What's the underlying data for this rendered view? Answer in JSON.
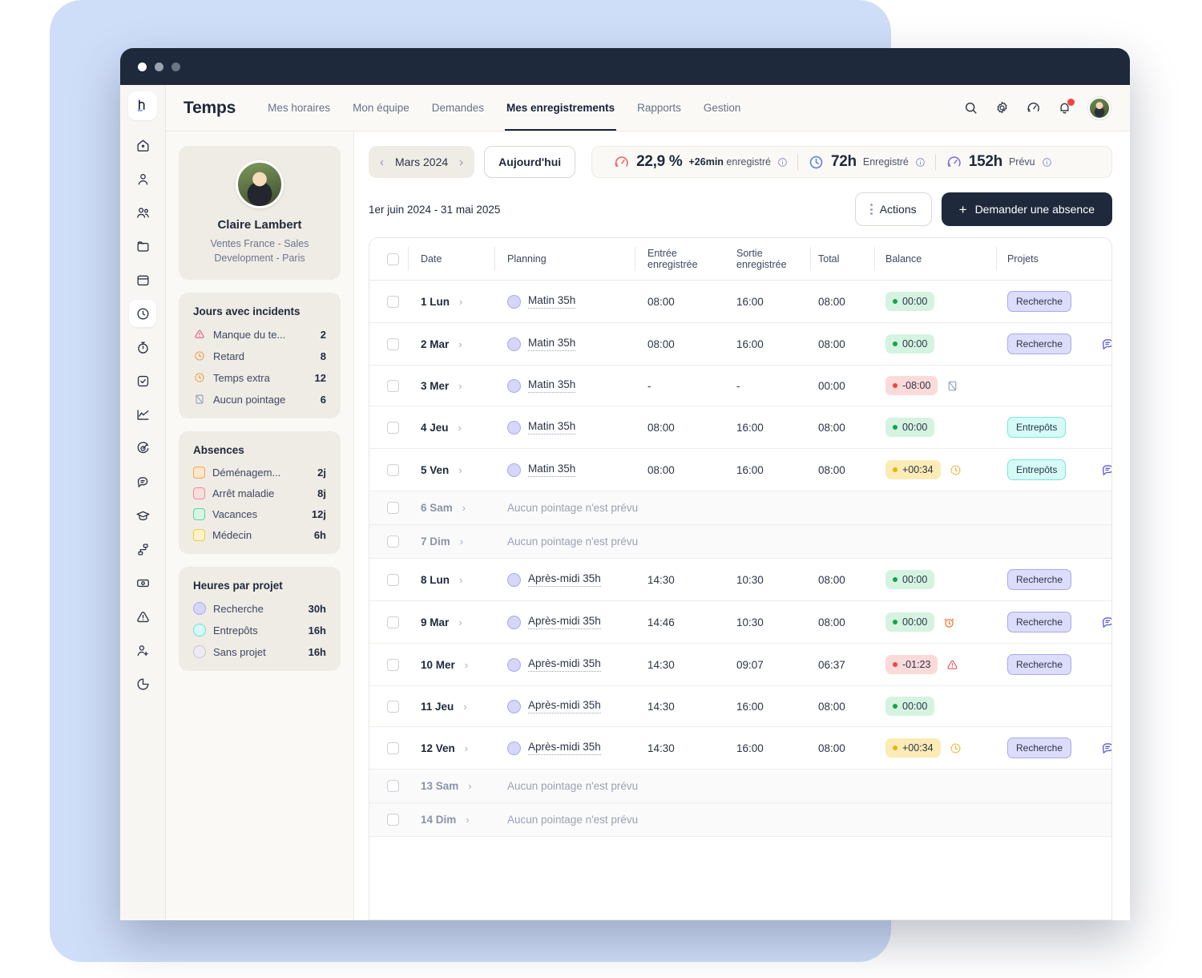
{
  "window": {
    "dots": [
      "close",
      "minimize",
      "maximize"
    ]
  },
  "header": {
    "brand": "Temps",
    "tabs": [
      {
        "label": "Mes horaires",
        "active": false
      },
      {
        "label": "Mon équipe",
        "active": false
      },
      {
        "label": "Demandes",
        "active": false
      },
      {
        "label": "Mes enregistrements",
        "active": true
      },
      {
        "label": "Rapports",
        "active": false
      },
      {
        "label": "Gestion",
        "active": false
      }
    ],
    "icons": [
      "search-icon",
      "gear-icon",
      "speedometer-icon",
      "bell-icon",
      "avatar"
    ]
  },
  "rail": {
    "logo": "h",
    "items": [
      {
        "name": "home-icon"
      },
      {
        "name": "user-icon"
      },
      {
        "name": "users-icon"
      },
      {
        "name": "folder-icon"
      },
      {
        "name": "calendar-icon"
      },
      {
        "name": "clock-icon",
        "active": true
      },
      {
        "name": "stopwatch-icon"
      },
      {
        "name": "check-square-icon"
      },
      {
        "name": "chart-line-icon"
      },
      {
        "name": "target-icon"
      },
      {
        "name": "chat-icon"
      },
      {
        "name": "graduation-cap-icon"
      },
      {
        "name": "workflow-icon"
      },
      {
        "name": "money-icon"
      },
      {
        "name": "alert-triangle-icon"
      },
      {
        "name": "user-plus-icon"
      },
      {
        "name": "pie-chart-icon"
      }
    ]
  },
  "profile": {
    "name": "Claire Lambert",
    "role": "Ventes France - Sales Development - Paris"
  },
  "incidents": {
    "title": "Jours avec incidents",
    "items": [
      {
        "icon": "alert-triangle-icon",
        "label": "Manque du te...",
        "value": "2",
        "color": "#e8607c"
      },
      {
        "icon": "clock-dotted-icon",
        "label": "Retard",
        "value": "8",
        "color": "#f0952e"
      },
      {
        "icon": "clock-dotted-icon",
        "label": "Temps extra",
        "value": "12",
        "color": "#f0952e"
      },
      {
        "icon": "no-punch-icon",
        "label": "Aucun pointage",
        "value": "6",
        "color": "#9aa2b4"
      }
    ]
  },
  "absences": {
    "title": "Absences",
    "items": [
      {
        "label": "Déménagem...",
        "value": "2j",
        "fill": "#fde7cc",
        "border": "#f0a64a"
      },
      {
        "label": "Arrêt maladie",
        "value": "8j",
        "fill": "#fbdde0",
        "border": "#f08a96"
      },
      {
        "label": "Vacances",
        "value": "12j",
        "fill": "#d4f7e4",
        "border": "#5dd3a0"
      },
      {
        "label": "Médecin",
        "value": "6h",
        "fill": "#fdf3c4",
        "border": "#efcd3f"
      }
    ]
  },
  "projects_hours": {
    "title": "Heures par projet",
    "items": [
      {
        "label": "Recherche",
        "value": "30h",
        "fill": "#d6d6fa",
        "border": "#a9a9ef"
      },
      {
        "label": "Entrepôts",
        "value": "16h",
        "fill": "#d4fbf6",
        "border": "#6fdfd4"
      },
      {
        "label": "Sans projet",
        "value": "16h",
        "fill": "#eceaf3",
        "border": "#c8c6d2"
      }
    ]
  },
  "toolbar": {
    "prev_label": "‹",
    "month": "Mars 2024",
    "next_label": "›",
    "today_label": "Aujourd'hui",
    "stats": [
      {
        "icon": "speedometer-red-icon",
        "value": "22,9 %",
        "sub_bold": "+26min",
        "sub": "enregistré"
      },
      {
        "icon": "clock-blue-icon",
        "value": "72h",
        "sub": "Enregistré"
      },
      {
        "icon": "speedometer-purple-icon",
        "value": "152h",
        "sub": "Prévu"
      }
    ]
  },
  "subbar": {
    "range": "1er juin 2024 - 31 mai 2025",
    "actions_label": "Actions",
    "request_label": "Demander une absence",
    "plus": "+"
  },
  "table": {
    "columns": [
      {
        "key": "check",
        "label": ""
      },
      {
        "key": "date",
        "label": "Date"
      },
      {
        "key": "planning",
        "label": "Planning"
      },
      {
        "key": "in",
        "label": "Entrée enregistrée"
      },
      {
        "key": "out",
        "label": "Sortie enregistrée"
      },
      {
        "key": "total",
        "label": "Total"
      },
      {
        "key": "balance",
        "label": "Balance"
      },
      {
        "key": "projects",
        "label": "Projets"
      },
      {
        "key": "note",
        "label": ""
      }
    ],
    "no_schedule_text": "Aucun pointage n'est prévu",
    "rows": [
      {
        "date": "1 Lun",
        "planning": "Matin 35h",
        "in": "08:00",
        "out": "16:00",
        "total": "08:00",
        "balance": "00:00",
        "balance_state": "ok",
        "flag": null,
        "project": "Recherche",
        "project_style": "recherche",
        "note": false,
        "off": false
      },
      {
        "date": "2 Mar",
        "planning": "Matin 35h",
        "in": "08:00",
        "out": "16:00",
        "total": "08:00",
        "balance": "00:00",
        "balance_state": "ok",
        "flag": null,
        "project": "Recherche",
        "project_style": "recherche",
        "note": true,
        "off": false
      },
      {
        "date": "3 Mer",
        "planning": "Matin 35h",
        "in": "-",
        "out": "-",
        "total": "00:00",
        "balance": "-08:00",
        "balance_state": "bad",
        "flag": "no-punch-icon",
        "project": null,
        "project_style": null,
        "note": false,
        "off": false
      },
      {
        "date": "4 Jeu",
        "planning": "Matin 35h",
        "in": "08:00",
        "out": "16:00",
        "total": "08:00",
        "balance": "00:00",
        "balance_state": "ok",
        "flag": null,
        "project": "Entrepôts",
        "project_style": "entrepots",
        "note": false,
        "off": false
      },
      {
        "date": "5 Ven",
        "planning": "Matin 35h",
        "in": "08:00",
        "out": "16:00",
        "total": "08:00",
        "balance": "+00:34",
        "balance_state": "warn",
        "flag": "clock-dotted-icon",
        "project": "Entrepôts",
        "project_style": "entrepots",
        "note": true,
        "off": false
      },
      {
        "date": "6 Sam",
        "planning": null,
        "off": true
      },
      {
        "date": "7 Dim",
        "planning": null,
        "off": true
      },
      {
        "date": "8 Lun",
        "planning": "Après-midi 35h",
        "in": "14:30",
        "out": "10:30",
        "total": "08:00",
        "balance": "00:00",
        "balance_state": "ok",
        "flag": null,
        "project": "Recherche",
        "project_style": "recherche",
        "note": false,
        "off": false
      },
      {
        "date": "9 Mar",
        "planning": "Après-midi 35h",
        "in": "14:46",
        "out": "10:30",
        "total": "08:00",
        "balance": "00:00",
        "balance_state": "ok",
        "flag": "alarm-icon",
        "project": "Recherche",
        "project_style": "recherche",
        "note": true,
        "off": false
      },
      {
        "date": "10 Mer",
        "planning": "Après-midi 35h",
        "in": "14:30",
        "out": "09:07",
        "total": "06:37",
        "balance": "-01:23",
        "balance_state": "bad",
        "flag": "alert-triangle-icon",
        "project": "Recherche",
        "project_style": "recherche",
        "note": false,
        "off": false
      },
      {
        "date": "11 Jeu",
        "planning": "Après-midi 35h",
        "in": "14:30",
        "out": "16:00",
        "total": "08:00",
        "balance": "00:00",
        "balance_state": "ok",
        "flag": null,
        "project": null,
        "project_style": null,
        "note": false,
        "off": false
      },
      {
        "date": "12 Ven",
        "planning": "Après-midi 35h",
        "in": "14:30",
        "out": "16:00",
        "total": "08:00",
        "balance": "+00:34",
        "balance_state": "warn",
        "flag": "clock-dotted-icon",
        "project": "Recherche",
        "project_style": "recherche",
        "note": true,
        "off": false
      },
      {
        "date": "13 Sam",
        "planning": null,
        "off": true
      },
      {
        "date": "14 Dim",
        "planning": null,
        "off": true
      }
    ]
  },
  "colors": {
    "dark": "#1e293b",
    "panel_blue": "#cfdef8",
    "bg_cream": "#faf9f6",
    "accent_purple": "#5b5bd6",
    "green": "#16a34a",
    "red": "#ef4444",
    "yellow": "#eab308"
  }
}
